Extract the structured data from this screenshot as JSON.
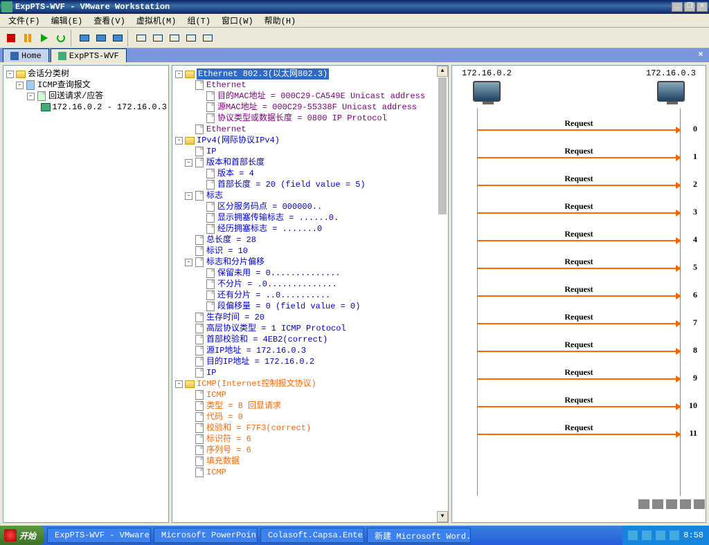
{
  "window": {
    "title": "ExpPTS-WVF - VMware Workstation",
    "min_btn": "_",
    "max_btn": "❐",
    "close_btn": "×"
  },
  "menu": {
    "items": [
      "文件(F)",
      "编辑(E)",
      "查看(V)",
      "虚拟机(M)",
      "组(T)",
      "窗口(W)",
      "帮助(H)"
    ]
  },
  "tabs": {
    "home": "Home",
    "vm": "ExpPTS-WVF",
    "close": "×"
  },
  "left_tree": {
    "root": "会话分类树",
    "n1": "ICMP查询报文",
    "n2": "回送请求/应答",
    "n3": "172.16.0.2 - 172.16.0.3"
  },
  "mid_tree": {
    "eth_hdr": "Ethernet 802.3(以太网802.3)",
    "eth": "Ethernet",
    "dst_mac": "目的MAC地址 = 000C29-CA549E Unicast address",
    "src_mac": "源MAC地址 = 000C29-55338F Unicast address",
    "proto_type": "协议类型或数据长度 = 0800 IP Protocol",
    "eth2": "Ethernet",
    "ipv4_hdr": "IPv4(网际协议IPv4)",
    "ip": "IP",
    "ver_hdr": "版本和首部长度",
    "ver": "版本 = 4",
    "hdrlen": "首部长度 = 20 (field value = 5)",
    "flags": "标志",
    "dscp": "区分服务码点 = 000000..",
    "ecn1": "显示拥塞传输标志 = ......0.",
    "ecn2": "经历拥塞标志 = .......0",
    "totlen": "总长度 = 28",
    "ident": "标识 = 10",
    "fragflags": "标志和分片偏移",
    "reserved": "保留未用 = 0..............",
    "nofrag": "不分片 = .0..............",
    "morefrag": "还有分片 = ..0..........",
    "fragoff": "段偏移量 = 0 (field value = 0)",
    "ttl": "生存时间 = 20",
    "upproto": "高层协议类型 = 1 ICMP Protocol",
    "checksum": "首部校验和 = 4EB2(correct)",
    "srcip": "源IP地址 = 172.16.0.3",
    "dstip": "目的IP地址 = 172.16.0.2",
    "ip2": "IP",
    "icmp_hdr": "ICMP(Internet控制报文协议)",
    "icmp": "ICMP",
    "type": "类型 = 8 回显请求",
    "code": "代码 = 0",
    "icmpchk": "校验和 = F7F3(correct)",
    "idnum": "标识符 = 6",
    "seq": "序列号 = 6",
    "payload": "填充数据",
    "icmp2": "ICMP"
  },
  "seq_diagram": {
    "host_left": "172.16.0.2",
    "host_right": "172.16.0.3",
    "arrows": [
      "Request",
      "Request",
      "Request",
      "Request",
      "Request",
      "Request",
      "Request",
      "Request",
      "Request",
      "Request",
      "Request",
      "Request"
    ]
  },
  "taskbar": {
    "start": "开始",
    "tasks": [
      "ExpPTS-WVF - VMware...",
      "Microsoft PowerPoin...",
      "Colasoft.Capsa.Ente...",
      "新建 Microsoft Word..."
    ],
    "time": "8:58"
  }
}
